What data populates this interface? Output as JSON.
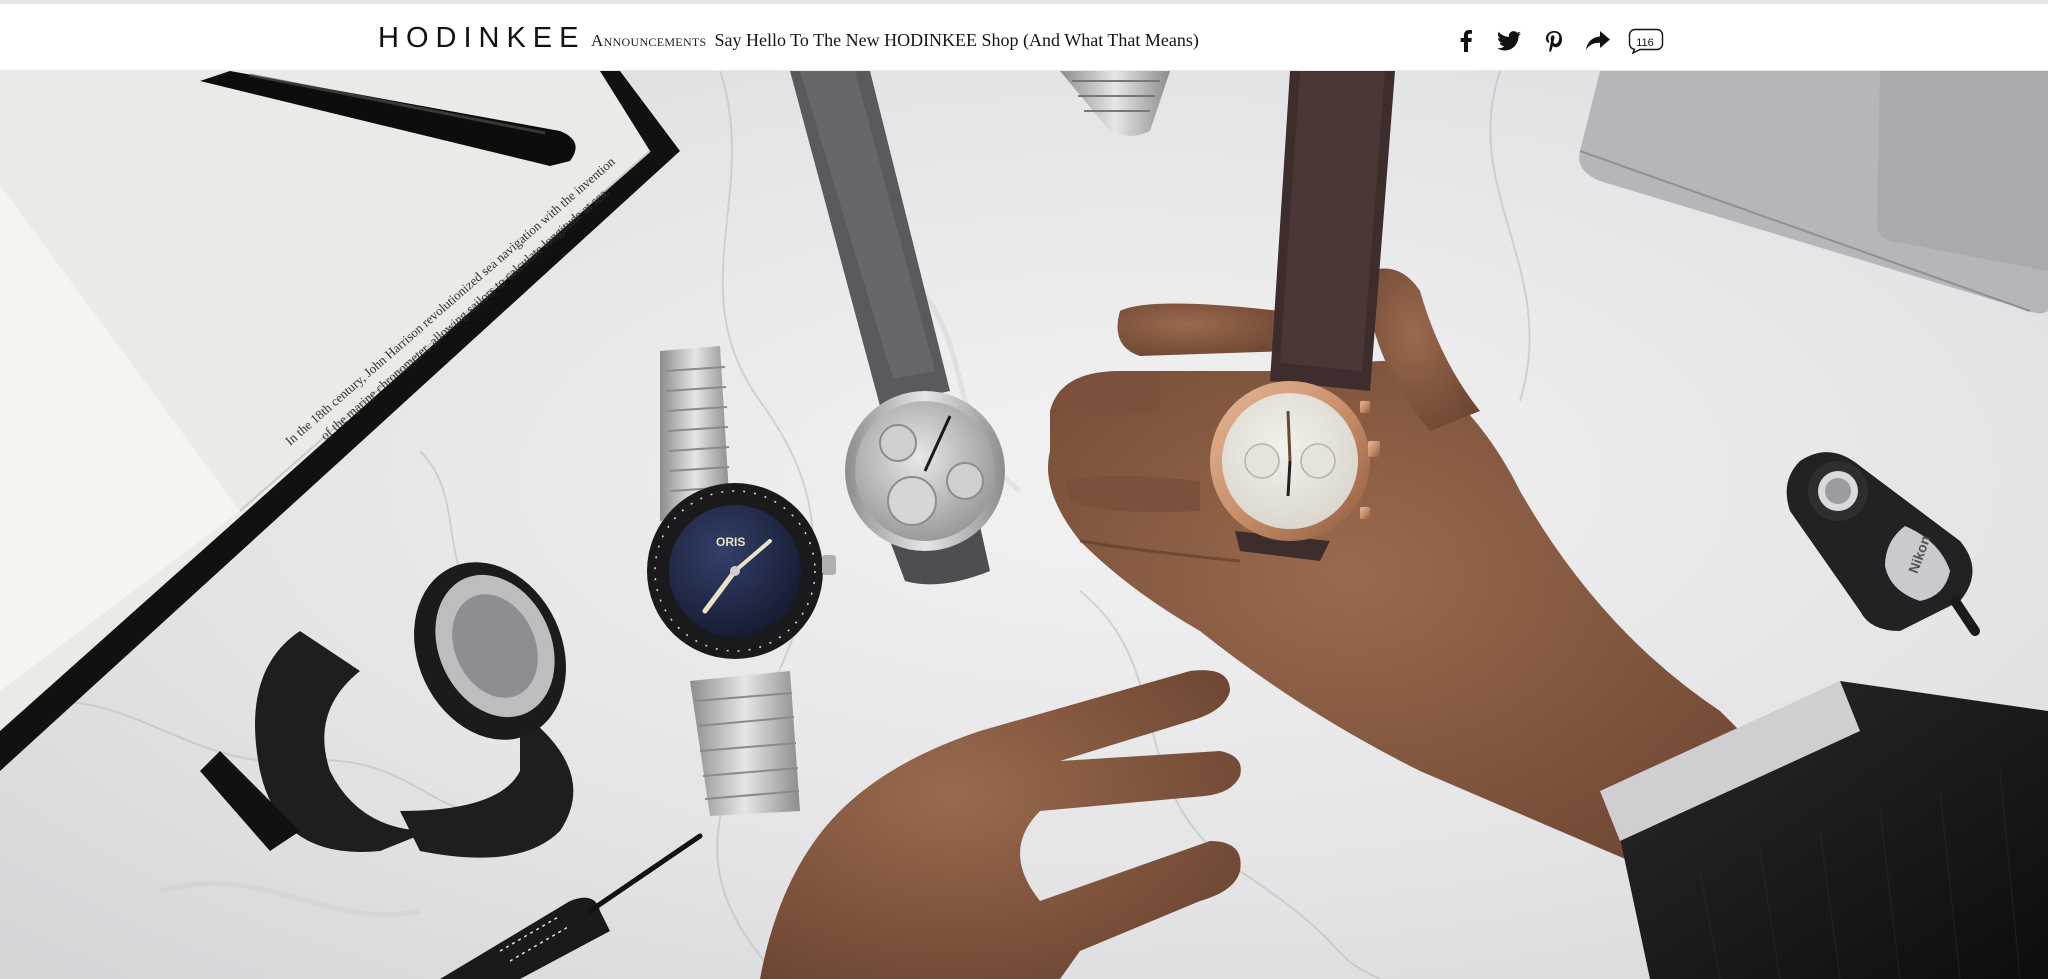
{
  "header": {
    "logo": "HODINKEE",
    "category": "Announcements",
    "title": "Say Hello To The New HODINKEE Shop (And What That Means)",
    "comment_count": "116",
    "social_icons": [
      "facebook-icon",
      "twitter-icon",
      "pinterest-icon",
      "share-icon",
      "comment-icon"
    ]
  },
  "hero": {
    "notebook_line_1": "In the 18th century, John Harrison revolutionized sea navigation with the invention",
    "notebook_line_2": "of the marine chronometer, allowing sailors to calculate longitude at sea.",
    "dive_watch_brand": "ORIS",
    "loupe_brand": "Nikon"
  },
  "colors": {
    "background": "#ffffff",
    "text": "#111111",
    "marble": "#e9e9ea",
    "rose_gold": "#c98f6a",
    "dial_navy": "#1d2743"
  }
}
